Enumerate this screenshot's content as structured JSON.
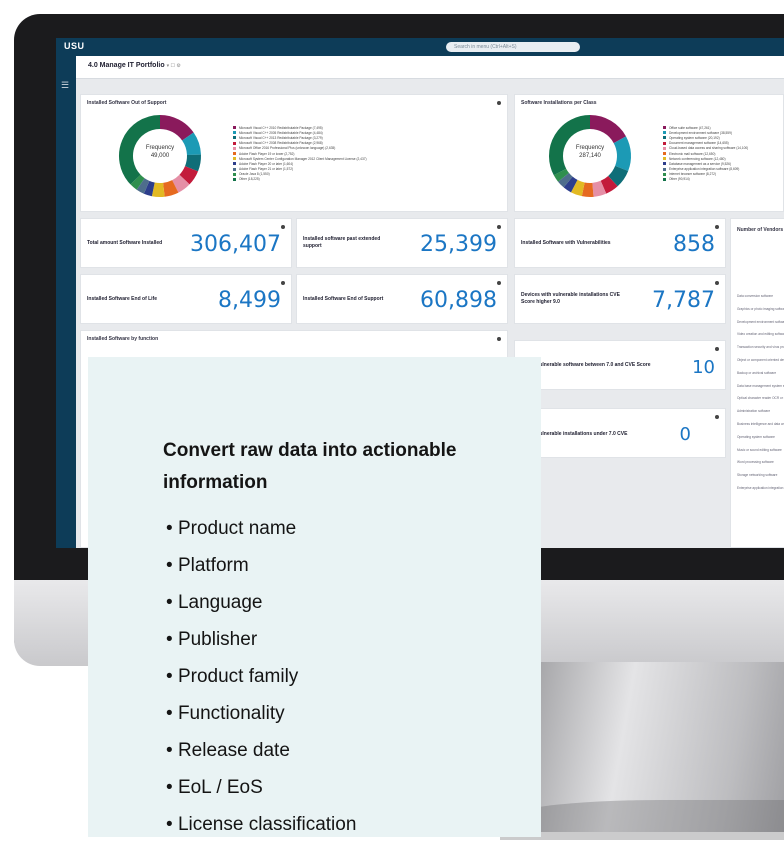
{
  "app": {
    "brand": "USU",
    "search_placeholder": "Search in menu (Ctrl+Alt+S)",
    "menu_icon": "hamburger-icon"
  },
  "page": {
    "title": "4.0 Manage IT Portfolio",
    "title_suffix": "▾  ☐ ⚙"
  },
  "donut_out_of_support": {
    "title": "Installed Software Out of Support",
    "center_label": "Frequency",
    "center_value": "49,000",
    "legend": [
      {
        "label": "Microsoft Visual C++ 2010 Redistributable Package (7,495)",
        "color": "#8a1a5c"
      },
      {
        "label": "Microsoft Visual C++ 2005 Redistributable Package (4,484)",
        "color": "#1c9ab5"
      },
      {
        "label": "Microsoft Visual C++ 2013 Redistributable Package (3,279)",
        "color": "#0f6e78"
      },
      {
        "label": "Microsoft Visual C++ 2008 Redistributable Package (2,968)",
        "color": "#c31b3b"
      },
      {
        "label": "Microsoft Office 2016 Professional Plus (unknown language) (2,635)",
        "color": "#e58fa6"
      },
      {
        "label": "Adobe Flash Player 19 or lower (2,752)",
        "color": "#e66a20"
      },
      {
        "label": "Microsoft System Center Configuration Manager 2012 Client Management License (2,437)",
        "color": "#e2b923"
      },
      {
        "label": "Adobe Flash Player 20 or later (1,604)",
        "color": "#2d3e8c"
      },
      {
        "label": "Adobe Flash Player 21 or later (1,572)",
        "color": "#4e6d8c"
      },
      {
        "label": "Oracle Java 8 (1,550)",
        "color": "#2f8f4e"
      },
      {
        "label": "Other (18,225)",
        "color": "#13734a"
      }
    ],
    "slices": [
      7495,
      4484,
      3279,
      2968,
      2635,
      2752,
      2437,
      1604,
      1572,
      1550,
      18225
    ]
  },
  "donut_per_class": {
    "title": "Software Installations per Class",
    "center_label": "Frequency",
    "center_value": "287,140",
    "legend": [
      {
        "label": "Office suite software (47,261)",
        "color": "#8a1a5c"
      },
      {
        "label": "Development environment software (38,559)",
        "color": "#1c9ab5"
      },
      {
        "label": "Operating system software (20,192)",
        "color": "#0f6e78"
      },
      {
        "label": "Document management software (14,655)",
        "color": "#c31b3b"
      },
      {
        "label": "Cloud-based data access and sharing software (14,100)",
        "color": "#e58fa6"
      },
      {
        "label": "Electronic mail software (12,650)",
        "color": "#e66a20"
      },
      {
        "label": "Network conferencing software (12,480)",
        "color": "#e2b923"
      },
      {
        "label": "Database management as a service (9,526)",
        "color": "#2d3e8c"
      },
      {
        "label": "Enterprise application integration software (8,609)",
        "color": "#4e6d8c"
      },
      {
        "label": "Internet browser software (8,272)",
        "color": "#2f8f4e"
      },
      {
        "label": "Other (90,914)",
        "color": "#13734a"
      }
    ],
    "slices": [
      47261,
      38559,
      20192,
      14655,
      14100,
      12650,
      12480,
      9526,
      8609,
      8272,
      90914
    ]
  },
  "kpis": [
    {
      "label": "Total amount Software Installed",
      "value": "306,407"
    },
    {
      "label": "Installed software past extended support",
      "value": "25,399"
    },
    {
      "label": "Installed Software with Vulnerabilities",
      "value": "858"
    },
    {
      "label": "Installed Software End of Life",
      "value": "8,499"
    },
    {
      "label": "Installed Software End of Support",
      "value": "60,898"
    },
    {
      "label": "Devices with vulnerable installations CVE Score higher 9.0",
      "value": "7,787"
    },
    {
      "label": "s with vulnerable software between 7.0 and CVE Score",
      "value": "10"
    },
    {
      "label": "s with vulnerable installations under 7.0 CVE",
      "value": "0"
    }
  ],
  "function_card": {
    "title": "Installed Software by function"
  },
  "vendors": {
    "title": "Number of Vendors",
    "rows": [
      "Data conversion software",
      "Graphics or photo imaging software",
      "Development environment software",
      "Video creation and editing software",
      "Transaction security and virus protection",
      "Object or component oriented development",
      "Backup or archival software",
      "Data base management system software",
      "Optical character reader OCR or scanning",
      "Administration software",
      "Business intelligence and data analysis",
      "Operating system software",
      "Music or sound editing software",
      "Word processing software",
      "Storage networking software",
      "Enterprise application integration"
    ]
  },
  "overlay": {
    "heading": "Convert raw data into actionable information",
    "items": [
      "Product name",
      "Platform",
      "Language",
      "Publisher",
      "Product family",
      "Functionality",
      "Release date",
      "EoL / EoS",
      "License classification"
    ]
  }
}
